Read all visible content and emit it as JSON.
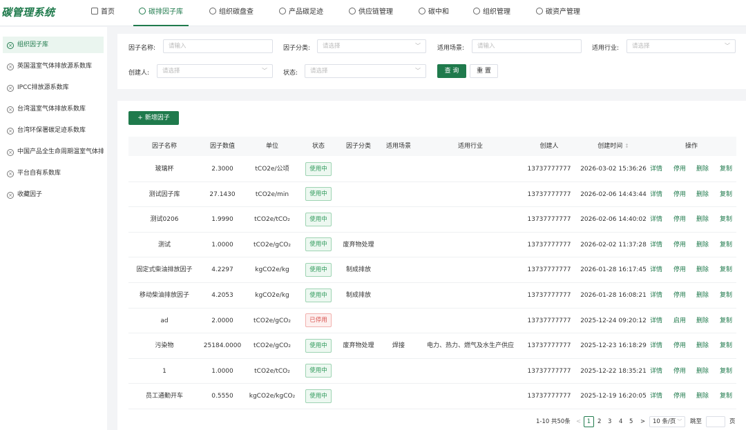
{
  "app": {
    "logo": "碳管理系统"
  },
  "nav": [
    {
      "label": "首页",
      "icon": "home-icon"
    },
    {
      "label": "碳排因子库",
      "icon": "factor-icon",
      "active": true
    },
    {
      "label": "组织碳盘查",
      "icon": "org-carbon-icon"
    },
    {
      "label": "产品碳足迹",
      "icon": "footprint-icon"
    },
    {
      "label": "供应链管理",
      "icon": "supply-chain-icon"
    },
    {
      "label": "碳中和",
      "icon": "neutral-icon"
    },
    {
      "label": "组织管理",
      "icon": "users-icon"
    },
    {
      "label": "碳资产管理",
      "icon": "asset-icon"
    }
  ],
  "sidebar": {
    "items": [
      {
        "label": "组织因子库",
        "active": true
      },
      {
        "label": "英国温室气体排放源系数库"
      },
      {
        "label": "IPCC排放源系数库"
      },
      {
        "label": "台湾温室气体排放系数库"
      },
      {
        "label": "台湾环保署碳足迹系数库"
      },
      {
        "label": "中国产品全生命周期温室气体排放系数库"
      },
      {
        "label": "平台自有系数库"
      },
      {
        "label": "收藏因子"
      }
    ]
  },
  "filters": {
    "factor_name_label": "因子名称:",
    "factor_name_placeholder": "请输入",
    "factor_type_label": "因子分类:",
    "factor_type_placeholder": "请选择",
    "scene_label": "适用场景:",
    "scene_placeholder": "请输入",
    "industry_label": "适用行业:",
    "industry_placeholder": "请选择",
    "creator_label": "创建人:",
    "creator_placeholder": "请选择",
    "status_label": "状态:",
    "status_placeholder": "请选择",
    "query_button": "查 询",
    "reset_button": "重 置"
  },
  "toolbar": {
    "add_button": "+ 新增因子"
  },
  "table": {
    "columns": [
      "因子名称",
      "因子数值",
      "单位",
      "状态",
      "因子分类",
      "适用场景",
      "适用行业",
      "创建人",
      "创建时间",
      "操作"
    ],
    "sort_icon": "↕",
    "rows": [
      {
        "name": "玻璃杯",
        "value": "2.3000",
        "unit": "tCO2e/公顷",
        "status": "使用中",
        "status_type": "on",
        "category": "",
        "scene": "",
        "industry": "",
        "creator": "13737777777",
        "created": "2026-03-02 15:36:26",
        "actions": [
          "详情",
          "停用",
          "删除",
          "复制"
        ]
      },
      {
        "name": "测试因子库",
        "value": "27.1430",
        "unit": "tCO2e/min",
        "status": "使用中",
        "status_type": "on",
        "category": "",
        "scene": "",
        "industry": "",
        "creator": "13737777777",
        "created": "2026-02-06 14:43:44",
        "actions": [
          "详情",
          "停用",
          "删除",
          "复制"
        ]
      },
      {
        "name": "测试0206",
        "value": "1.9990",
        "unit": "tCO2e/tCO₂",
        "status": "使用中",
        "status_type": "on",
        "category": "",
        "scene": "",
        "industry": "",
        "creator": "13737777777",
        "created": "2026-02-06 14:40:02",
        "actions": [
          "详情",
          "停用",
          "删除",
          "复制"
        ]
      },
      {
        "name": "测试",
        "value": "1.0000",
        "unit": "tCO2e/gCO₂",
        "status": "使用中",
        "status_type": "on",
        "category": "废弃物处理",
        "scene": "",
        "industry": "",
        "creator": "13737777777",
        "created": "2026-02-02 11:37:28",
        "actions": [
          "详情",
          "停用",
          "删除",
          "复制"
        ]
      },
      {
        "name": "固定式柴油排放因子",
        "value": "4.2297",
        "unit": "kgCO2e/kg",
        "status": "使用中",
        "status_type": "on",
        "category": "制成排放",
        "scene": "",
        "industry": "",
        "creator": "13737777777",
        "created": "2026-01-28 16:17:45",
        "actions": [
          "详情",
          "停用",
          "删除",
          "复制"
        ]
      },
      {
        "name": "移动柴油排放因子",
        "value": "4.2053",
        "unit": "kgCO2e/kg",
        "status": "使用中",
        "status_type": "on",
        "category": "制成排放",
        "scene": "",
        "industry": "",
        "creator": "13737777777",
        "created": "2026-01-28 16:08:21",
        "actions": [
          "详情",
          "停用",
          "删除",
          "复制"
        ]
      },
      {
        "name": "ad",
        "value": "2.0000",
        "unit": "tCO2e/gCO₂",
        "status": "已停用",
        "status_type": "off",
        "category": "",
        "scene": "",
        "industry": "",
        "creator": "13737777777",
        "created": "2025-12-24 09:20:12",
        "actions": [
          "详情",
          "启用",
          "删除",
          "复制"
        ]
      },
      {
        "name": "污染物",
        "value": "25184.0000",
        "unit": "tCO2e/gCO₂",
        "status": "使用中",
        "status_type": "on",
        "category": "废弃物处理",
        "scene": "焊接",
        "industry": "电力、热力、燃气及水生产供应",
        "creator": "13737777777",
        "created": "2025-12-23 16:18:29",
        "actions": [
          "详情",
          "停用",
          "删除",
          "复制"
        ]
      },
      {
        "name": "1",
        "value": "1.0000",
        "unit": "tCO2e/tCO₂",
        "status": "使用中",
        "status_type": "on",
        "category": "",
        "scene": "",
        "industry": "",
        "creator": "13737777777",
        "created": "2025-12-22 18:35:21",
        "actions": [
          "详情",
          "停用",
          "删除",
          "复制"
        ]
      },
      {
        "name": "员工通勤开车",
        "value": "0.5550",
        "unit": "kgCO2e/kgCO₂",
        "status": "使用中",
        "status_type": "on",
        "category": "",
        "scene": "",
        "industry": "",
        "creator": "13737777777",
        "created": "2025-12-19 16:20:05",
        "actions": [
          "详情",
          "停用",
          "删除",
          "复制"
        ]
      }
    ]
  },
  "pagination": {
    "summary": "1-10 共50条",
    "prev": "<",
    "pages": [
      "1",
      "2",
      "3",
      "4",
      "5"
    ],
    "current": "1",
    "next": ">",
    "page_size": "10 条/页",
    "jump_label": "跳至",
    "page_unit": "页"
  },
  "colors": {
    "brand": "#1f7a4c",
    "active_tag": "#2f9a5b",
    "disabled_tag": "#d9534f"
  }
}
